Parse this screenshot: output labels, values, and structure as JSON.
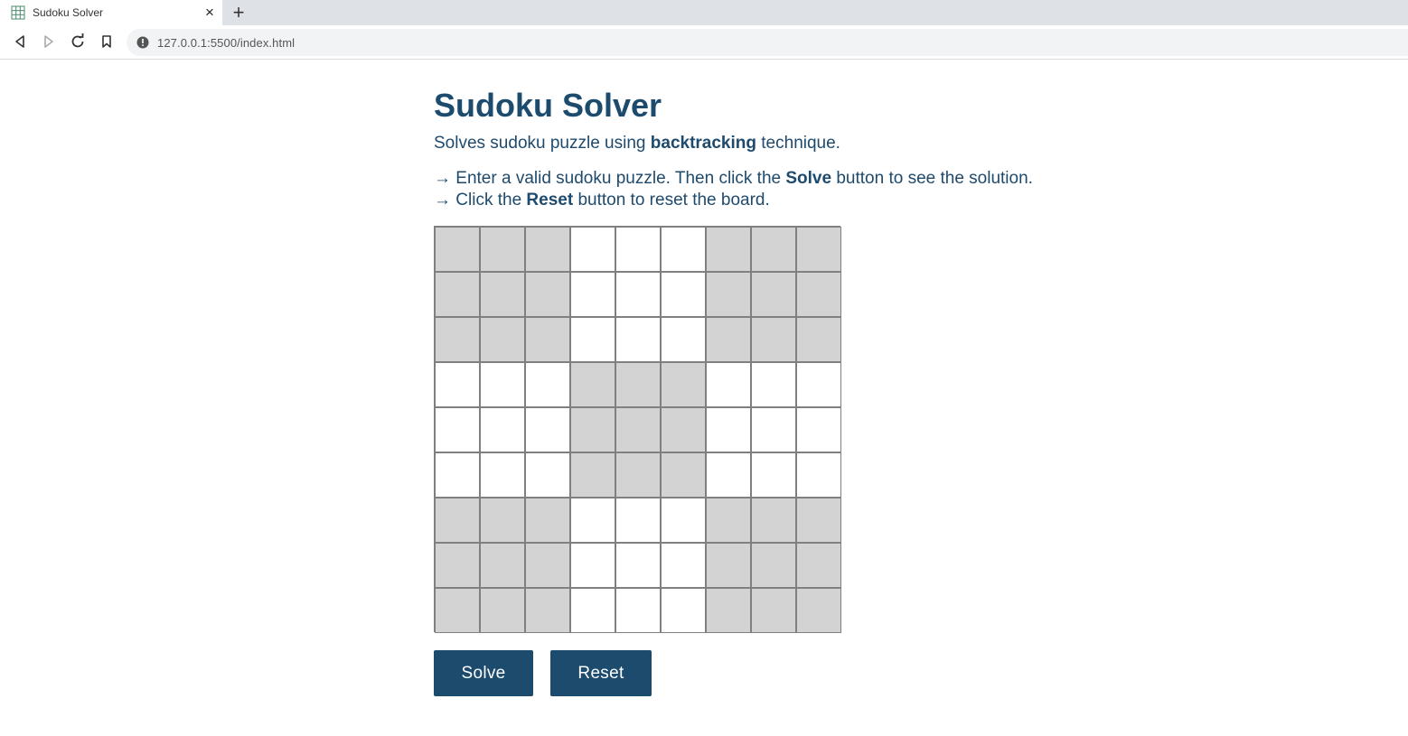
{
  "browser": {
    "tab_title": "Sudoku Solver",
    "new_tab_label": "+",
    "close_label": "×",
    "url": "127.0.0.1:5500/index.html"
  },
  "page": {
    "title": "Sudoku Solver",
    "subtitle_pre": "Solves sudoku puzzle using ",
    "subtitle_bold": "backtracking",
    "subtitle_post": " technique.",
    "instruction1_pre": "→ Enter a valid sudoku puzzle. Then click the ",
    "instruction1_bold": "Solve",
    "instruction1_post": " button to see the solution.",
    "instruction2_pre": "→ Click the ",
    "instruction2_bold": "Reset",
    "instruction2_post": " button to reset the board."
  },
  "board": {
    "size": 9,
    "values": [
      [
        "",
        "",
        "",
        "",
        "",
        "",
        "",
        "",
        ""
      ],
      [
        "",
        "",
        "",
        "",
        "",
        "",
        "",
        "",
        ""
      ],
      [
        "",
        "",
        "",
        "",
        "",
        "",
        "",
        "",
        ""
      ],
      [
        "",
        "",
        "",
        "",
        "",
        "",
        "",
        "",
        ""
      ],
      [
        "",
        "",
        "",
        "",
        "",
        "",
        "",
        "",
        ""
      ],
      [
        "",
        "",
        "",
        "",
        "",
        "",
        "",
        "",
        ""
      ],
      [
        "",
        "",
        "",
        "",
        "",
        "",
        "",
        "",
        ""
      ],
      [
        "",
        "",
        "",
        "",
        "",
        "",
        "",
        "",
        ""
      ],
      [
        "",
        "",
        "",
        "",
        "",
        "",
        "",
        "",
        ""
      ]
    ],
    "shaded_color": "#d3d3d3",
    "unshaded_color": "#ffffff"
  },
  "buttons": {
    "solve_label": "Solve",
    "reset_label": "Reset",
    "color": "#1c4b6e"
  }
}
